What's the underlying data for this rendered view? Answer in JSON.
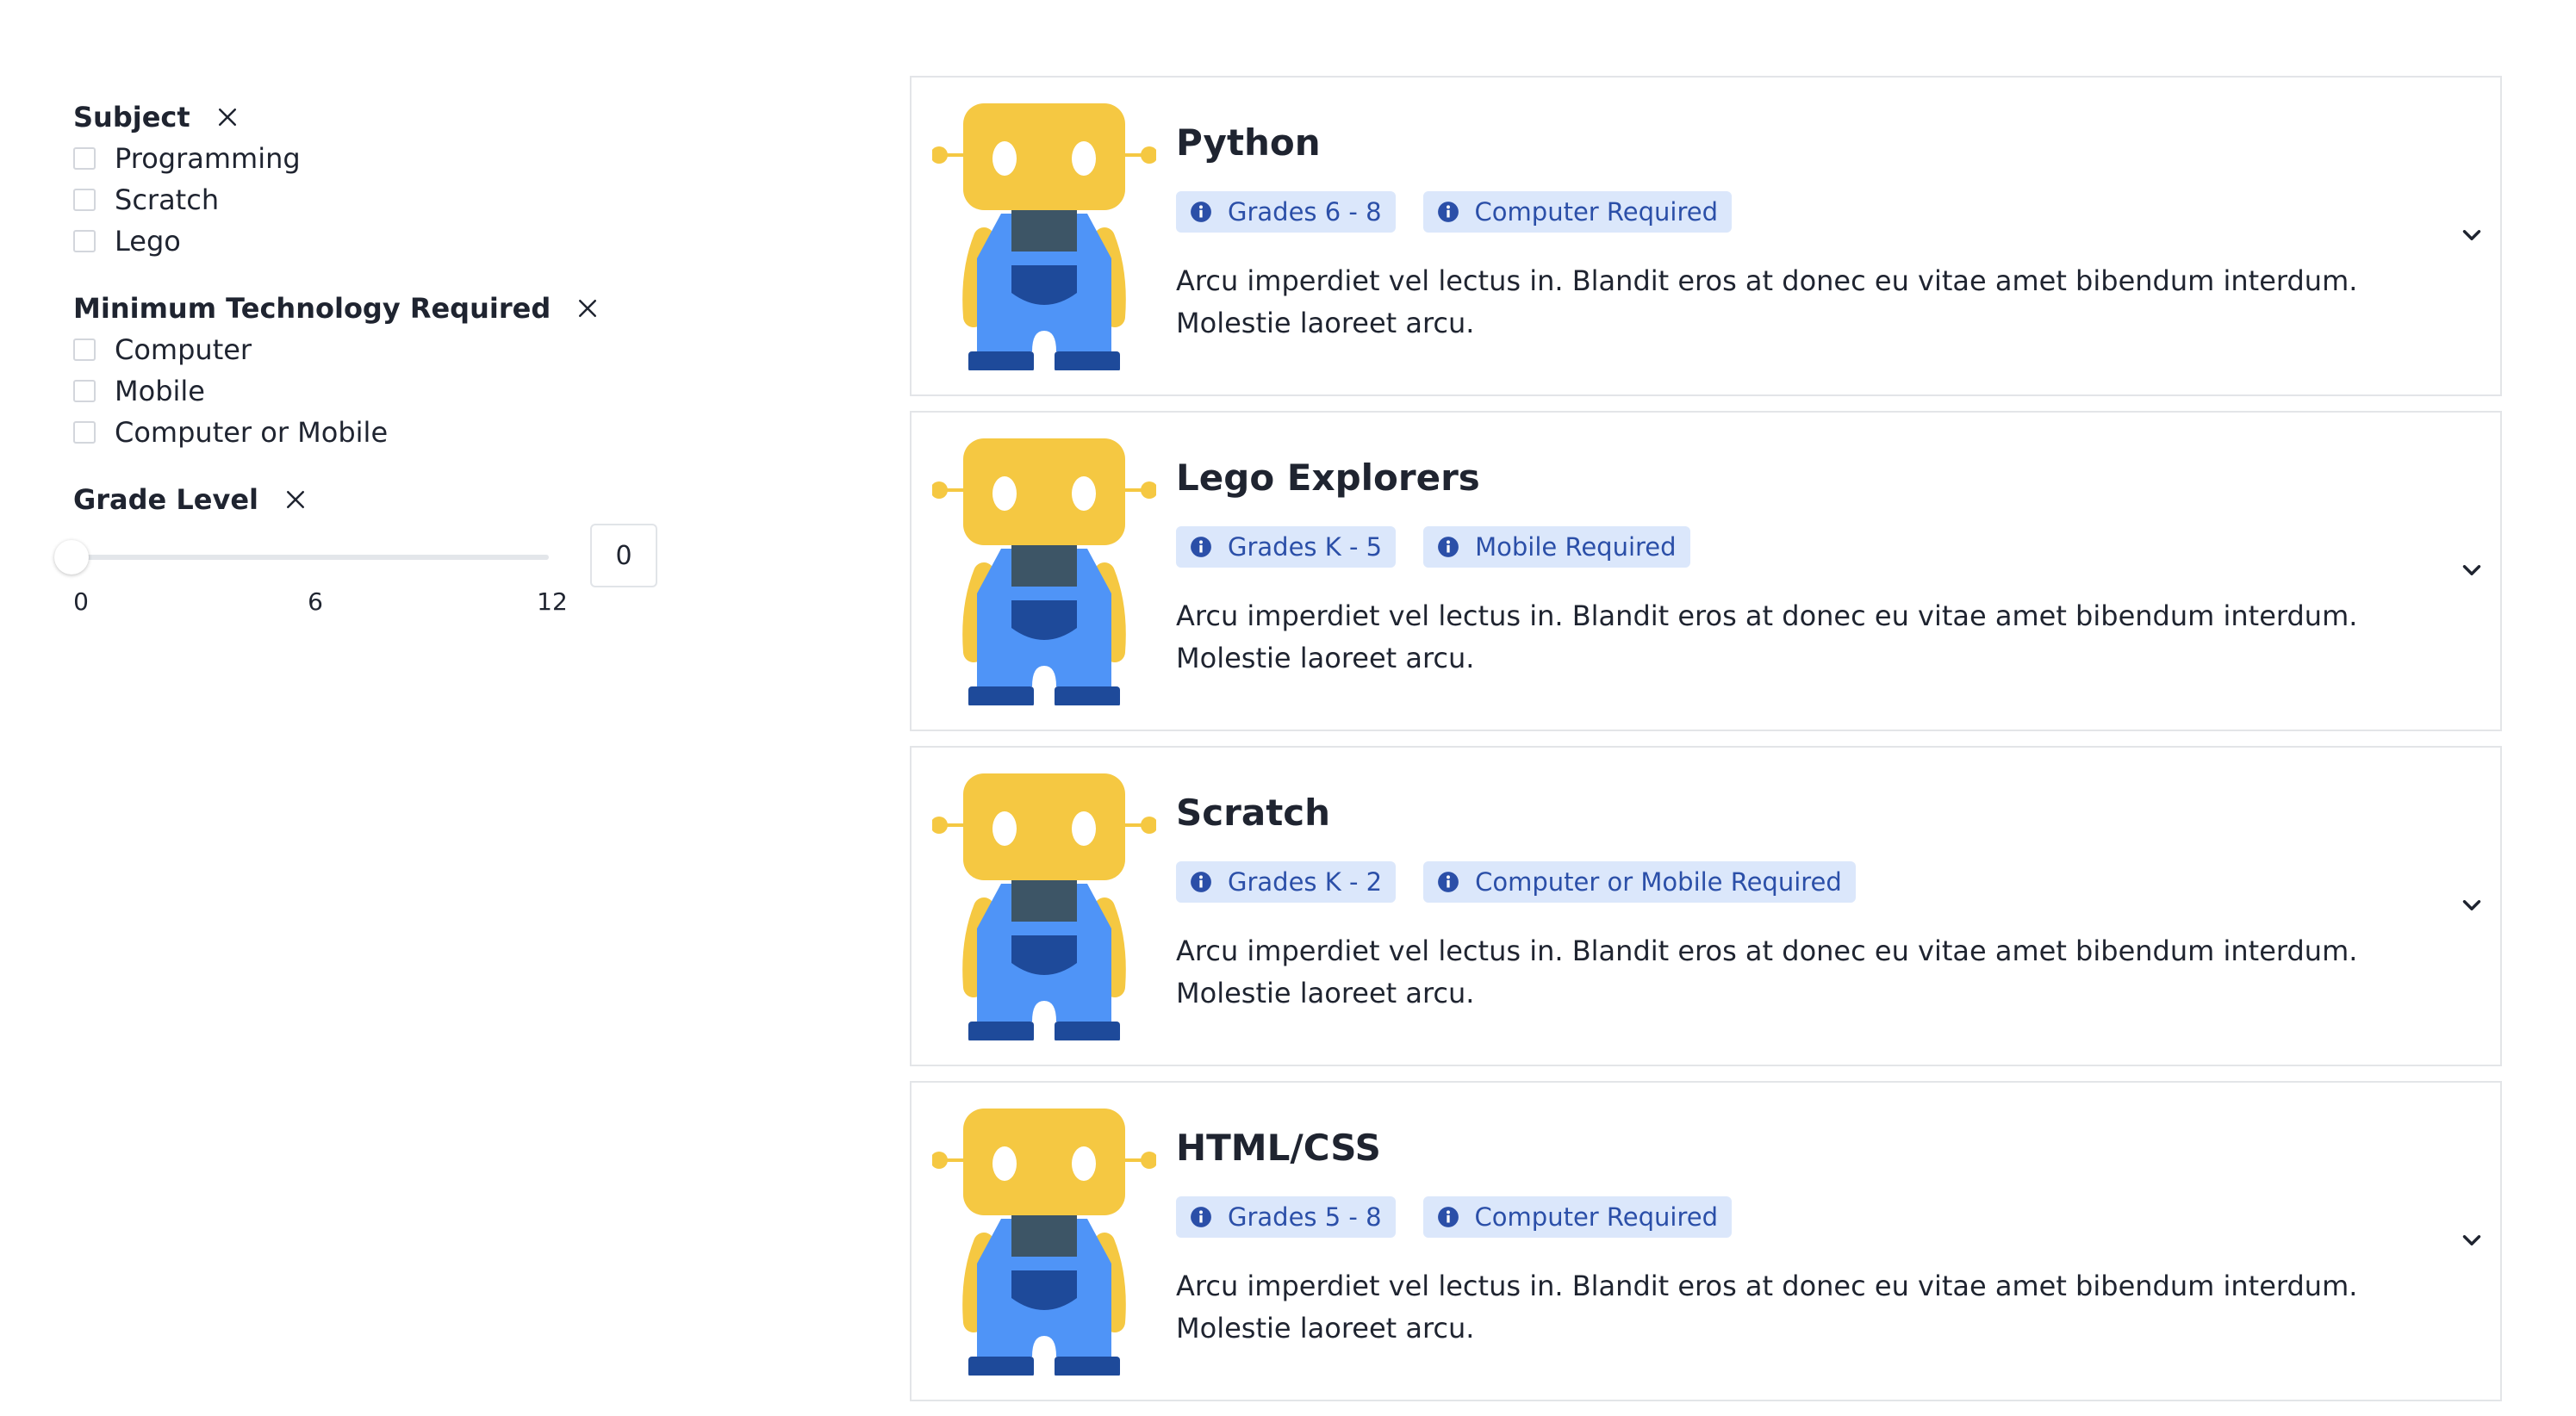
{
  "filters": {
    "subject": {
      "title": "Subject",
      "options": [
        {
          "label": "Programming",
          "checked": false
        },
        {
          "label": "Scratch",
          "checked": false
        },
        {
          "label": "Lego",
          "checked": false
        }
      ]
    },
    "technology": {
      "title": "Minimum Technology Required",
      "options": [
        {
          "label": "Computer",
          "checked": false
        },
        {
          "label": "Mobile",
          "checked": false
        },
        {
          "label": "Computer or Mobile",
          "checked": false
        }
      ]
    },
    "grade": {
      "title": "Grade Level",
      "ticks": [
        "0",
        "6",
        "12"
      ],
      "value": "0",
      "min": 0,
      "max": 12
    }
  },
  "courses": [
    {
      "title": "Python",
      "grade_badge": "Grades 6 - 8",
      "tech_badge": "Computer Required",
      "description": "Arcu imperdiet vel lectus in. Blandit eros at donec eu vitae amet bibendum interdum. Molestie laoreet arcu."
    },
    {
      "title": "Lego Explorers",
      "grade_badge": "Grades K - 5",
      "tech_badge": "Mobile Required",
      "description": "Arcu imperdiet vel lectus in. Blandit eros at donec eu vitae amet bibendum interdum. Molestie laoreet arcu."
    },
    {
      "title": "Scratch",
      "grade_badge": "Grades K - 2",
      "tech_badge": "Computer or Mobile Required",
      "description": "Arcu imperdiet vel lectus in. Blandit eros at donec eu vitae amet bibendum interdum. Molestie laoreet arcu."
    },
    {
      "title": "HTML/CSS",
      "grade_badge": "Grades 5 - 8",
      "tech_badge": "Computer Required",
      "description": "Arcu imperdiet vel lectus in. Blandit eros at donec eu vitae amet bibendum interdum. Molestie laoreet arcu."
    }
  ],
  "icons": {
    "clear": "close-icon",
    "info": "info-icon",
    "expand": "chevron-down-icon",
    "course_image": "robot-mascot-icon"
  },
  "colors": {
    "badge_bg": "#dbe7fb",
    "badge_text": "#2b4fa8",
    "robot_head": "#f5c842",
    "robot_body": "#4f94f7",
    "robot_dark": "#1e4a9a"
  }
}
